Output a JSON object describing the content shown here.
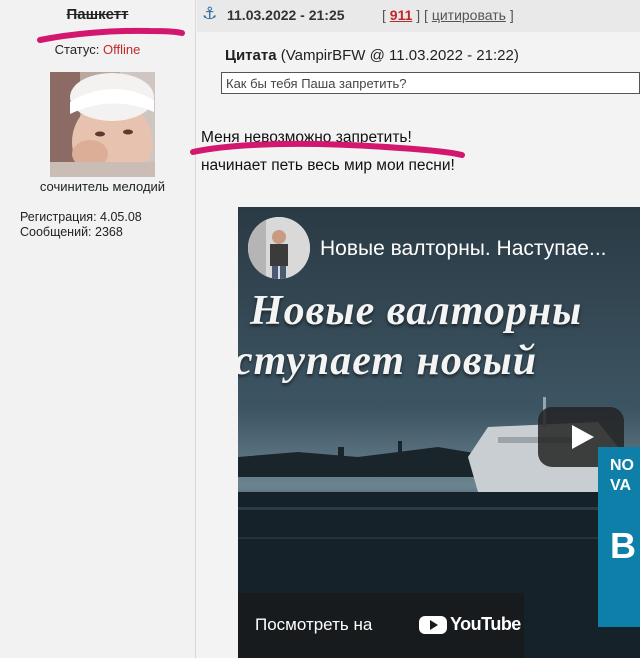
{
  "user": {
    "name": "Пашкетт",
    "status_label": "Статус:",
    "status_value": "Offline",
    "title": "сочинитель мелодий",
    "registration": "Регистрация: 4.05.08",
    "messages": "Сообщений: 2368"
  },
  "post": {
    "anchor_icon": "anchor-icon",
    "datetime": "11.03.2022 - 21:25",
    "open_bracket": "[",
    "post_number": "911",
    "mid_bracket": "] [",
    "cite_label": "цитировать",
    "close_bracket": "]",
    "quote_label": "Цитата",
    "quote_meta": "(VampirBFW @ 11.03.2022 - 21:22)",
    "quote_text": "Как бы тебя Паша запретить?",
    "line1": "Меня невозможно запретить!",
    "line2": "начинает петь весь мир мои песни!"
  },
  "video": {
    "title": "Новые валторны. Наступае...",
    "big_line1": "Новые валторны",
    "big_line2": "ступает новый",
    "watch_label": "Посмотреть на",
    "youtube_text": "YouTube",
    "side_card_a": "NO",
    "side_card_b": "VA",
    "side_card_c": "B"
  },
  "colors": {
    "accent_red": "#c02828",
    "pen_pink": "#d4176e",
    "anchor_blue": "#2d6a9f"
  }
}
